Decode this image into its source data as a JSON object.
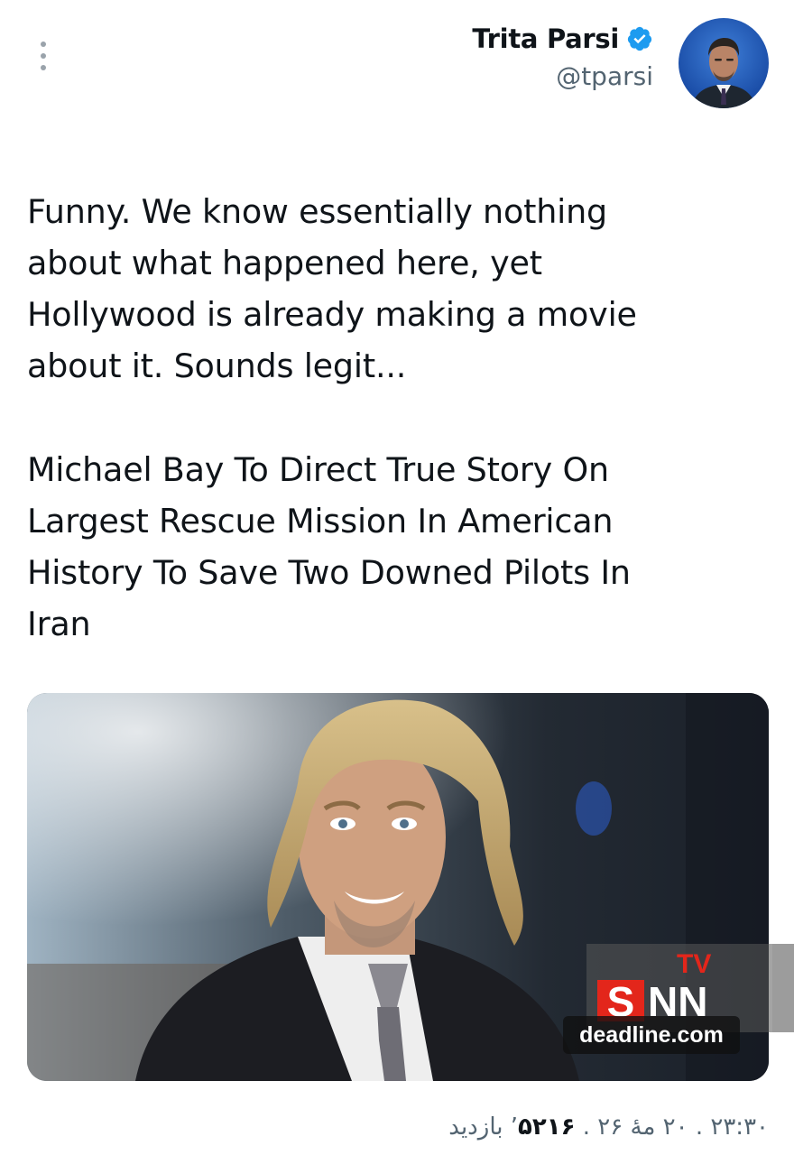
{
  "author": {
    "display_name": "Trita Parsi",
    "handle": "@tparsi",
    "verified": true,
    "avatar_icon": "profile-photo"
  },
  "menu_icon": "more-options-vertical-icon",
  "tweet": {
    "paragraphs": [
      [
        "Funny. We know essentially nothing",
        "about what happened here, yet",
        "Hollywood is already making a movie",
        "about it. Sounds legit..."
      ],
      [
        "Michael Bay To Direct True Story On",
        "Largest Rescue Mission In American",
        "History To Save Two Downed Pilots In",
        "Iran"
      ]
    ]
  },
  "media": {
    "source_label": "deadline.com",
    "watermark_tv": "TV",
    "watermark_snn": "SNN"
  },
  "meta": {
    "time": "۲۳:۳۰",
    "separator": " . ",
    "date": "۲۰ مهٔ ۲۶",
    "views_count": "۵۲۱۶",
    "views_suffix": "’ بازدید"
  },
  "colors": {
    "verified": "#1d9bf0",
    "secondary_text": "#536471",
    "snn_red": "#e3261b"
  }
}
